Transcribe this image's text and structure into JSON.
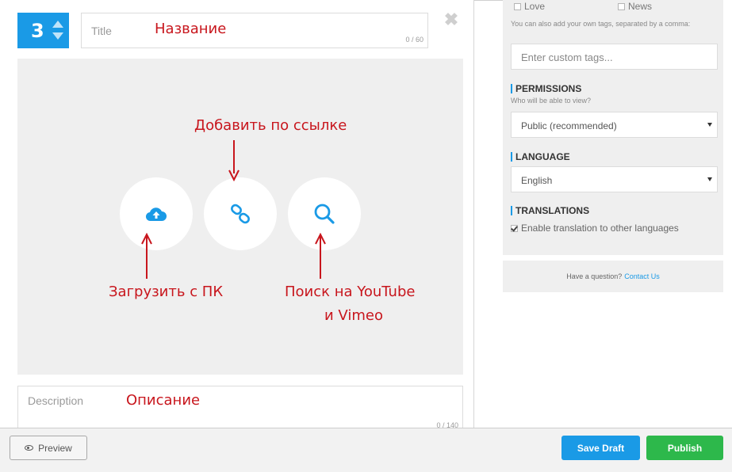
{
  "editor": {
    "item_number": "3",
    "title": {
      "placeholder": "Title",
      "counter": "0 / 60"
    },
    "description": {
      "placeholder": "Description",
      "counter": "0 / 140"
    }
  },
  "media": {
    "actions": [
      {
        "id": "upload",
        "icon": "cloud-upload-icon"
      },
      {
        "id": "link",
        "icon": "link-icon"
      },
      {
        "id": "search",
        "icon": "search-icon"
      }
    ]
  },
  "annotations": {
    "title": "Название",
    "link": "Добавить по ссылке",
    "upload": "Загрузить с ПК",
    "search_line1": "Поиск на YouTube",
    "search_line2": "и Vimeo",
    "description": "Описание",
    "color": "#c8161d"
  },
  "sidebar": {
    "tags": [
      {
        "label": "Love",
        "checked": false
      },
      {
        "label": "News",
        "checked": false
      }
    ],
    "custom_tags_hint": "You can also add your own tags, separated by a comma:",
    "custom_tags_placeholder": "Enter custom tags...",
    "permissions": {
      "heading": "PERMISSIONS",
      "subheading": "Who will be able to view?",
      "selected": "Public (recommended)"
    },
    "language": {
      "heading": "LANGUAGE",
      "selected": "English"
    },
    "translations": {
      "heading": "TRANSLATIONS",
      "checkbox_label": "Enable translation to other languages",
      "checked": true
    },
    "help": {
      "text": "Have a question?",
      "link": "Contact Us"
    }
  },
  "footer": {
    "preview_label": "Preview",
    "save_draft_label": "Save Draft",
    "publish_label": "Publish"
  },
  "colors": {
    "accent": "#1a9ae6",
    "publish": "#2db84b",
    "panel_bg": "#efefef"
  }
}
